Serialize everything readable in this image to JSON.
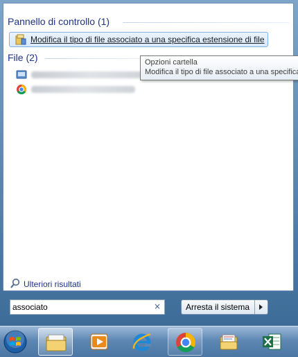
{
  "search_results": {
    "groups": [
      {
        "title": "Pannello di controllo (1)"
      },
      {
        "title": "File (2)"
      }
    ],
    "control_panel_item": {
      "label": "Modifica il tipo di file associato a una specifica estensione di file",
      "icon": "folder-options-icon"
    },
    "file_items": [
      {
        "icon": "document-icon"
      },
      {
        "icon": "chrome-html-icon"
      }
    ],
    "more_results_label": "Ulteriori risultati"
  },
  "tooltip": {
    "title": "Opzioni cartella",
    "description": "Modifica il tipo di file associato a una specifica estensione di file"
  },
  "search": {
    "value": "associato",
    "clear_icon": "×"
  },
  "shutdown": {
    "label": "Arresta il sistema"
  },
  "taskbar": {
    "items": [
      {
        "icon": "windows-start-orb"
      },
      {
        "icon": "file-explorer-icon",
        "state": "open"
      },
      {
        "icon": "media-player-icon"
      },
      {
        "icon": "internet-explorer-icon"
      },
      {
        "icon": "chrome-icon",
        "state": "open"
      },
      {
        "icon": "mail-folder-icon"
      },
      {
        "icon": "excel-icon"
      }
    ]
  }
}
